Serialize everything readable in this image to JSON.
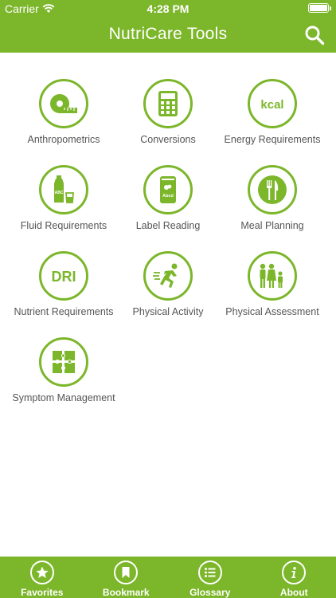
{
  "status": {
    "carrier": "Carrier",
    "time": "4:28 PM"
  },
  "header": {
    "title": "NutriCare Tools",
    "search_icon": "search-icon"
  },
  "tools": [
    {
      "label": "Anthropometrics",
      "icon": "tape-measure-icon"
    },
    {
      "label": "Conversions",
      "icon": "calculator-icon"
    },
    {
      "label": "Energy Requirements",
      "icon": "kcal-icon",
      "icon_text": "kcal"
    },
    {
      "label": "Fluid Requirements",
      "icon": "bottle-glass-icon",
      "icon_text": "ABC"
    },
    {
      "label": "Label Reading",
      "icon": "can-label-icon",
      "icon_text": "Abcd"
    },
    {
      "label": "Meal Planning",
      "icon": "plate-fork-knife-icon"
    },
    {
      "label": "Nutrient Requirements",
      "icon": "dri-icon",
      "icon_text": "DRI"
    },
    {
      "label": "Physical Activity",
      "icon": "running-person-icon"
    },
    {
      "label": "Physical Assessment",
      "icon": "family-icon"
    },
    {
      "label": "Symptom Management",
      "icon": "puzzle-icon"
    }
  ],
  "tabs": [
    {
      "label": "Favorites",
      "icon": "star-icon"
    },
    {
      "label": "Bookmark",
      "icon": "bookmark-icon"
    },
    {
      "label": "Glossary",
      "icon": "list-icon"
    },
    {
      "label": "About",
      "icon": "info-icon"
    }
  ],
  "colors": {
    "brand_green": "#7cb62a",
    "label_gray": "#555555"
  }
}
